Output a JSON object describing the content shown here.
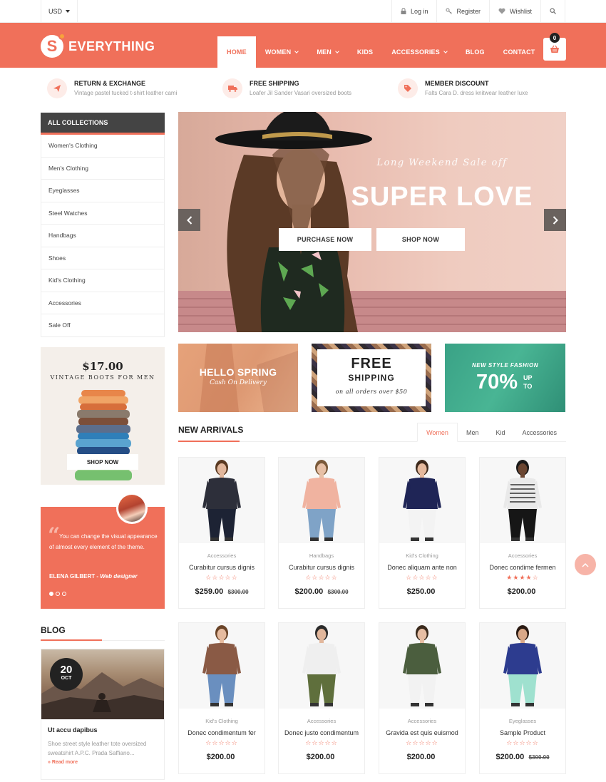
{
  "topbar": {
    "currency": "USD",
    "login": "Log in",
    "register": "Register",
    "wishlist": "Wishlist"
  },
  "brand": {
    "logo_letter": "S",
    "name": "EVERYTHING",
    "accent": "#f0705a"
  },
  "nav": {
    "home": "HOME",
    "women": "WOMEN",
    "men": "MEN",
    "kids": "KIDS",
    "accessories": "ACCESSORIES",
    "blog": "BLOG",
    "contact": "CONTACT"
  },
  "cart": {
    "count": "0"
  },
  "features": [
    {
      "title": "RETURN & EXCHANGE",
      "desc": "Vintage pastel tucked t-shirt leather cami"
    },
    {
      "title": "FREE SHIPPING",
      "desc": "Loafer Jil Sander Vasari oversized boots"
    },
    {
      "title": "MEMBER DISCOUNT",
      "desc": "Falts Cara D. dress knitwear leather luxe"
    }
  ],
  "collections": {
    "header": "ALL COLLECTIONS",
    "items": [
      "Women's Clothing",
      "Men's Clothing",
      "Eyeglasses",
      "Steel Watches",
      "Handbags",
      "Shoes",
      "Kid's Clothing",
      "Accessories",
      "Sale Off"
    ]
  },
  "promo": {
    "price": "$17.00",
    "subtitle": "VINTAGE BOOTS FOR MEN",
    "button": "SHOP NOW"
  },
  "testimonial": {
    "text": "You can change the visual appearance of almost every element of the theme.",
    "author": "ELENA GILBERT",
    "role": "Web designer"
  },
  "blog": {
    "title": "BLOG",
    "day": "20",
    "month": "OCT",
    "post_title": "Ut accu dapibus",
    "excerpt": "Shoe street style leather tote oversized sweatshirt A.P.C. Prada Saffiano...",
    "more": "» Read more"
  },
  "slider": {
    "kicker": "Long Weekend Sale off",
    "heading": "SUPER LOVE",
    "purchase": "PURCHASE NOW",
    "shop": "SHOP NOW"
  },
  "banners": {
    "spring_title": "HELLO SPRING",
    "spring_sub": "Cash On Delivery",
    "free": "FREE",
    "shipping": "SHIPPING",
    "shipping_note": "on all orders over $50",
    "fashion_kicker": "NEW STYLE FASHION",
    "fashion_pct": "70%",
    "fashion_up": "UP",
    "fashion_to": "TO"
  },
  "new_arrivals": {
    "title": "NEW ARRIVALS",
    "tabs": [
      "Women",
      "Men",
      "Kid",
      "Accessories"
    ]
  },
  "products": [
    {
      "category": "Accessories",
      "name": "Curabitur cursus dignis",
      "price": "$259.00",
      "old_price": "$300.00",
      "rating": 0
    },
    {
      "category": "Handbags",
      "name": "Curabitur cursus dignis",
      "price": "$200.00",
      "old_price": "$300.00",
      "rating": 0
    },
    {
      "category": "Kid's Clothing",
      "name": "Donec aliquam ante non",
      "price": "$250.00",
      "old_price": "",
      "rating": 0
    },
    {
      "category": "Accessories",
      "name": "Donec condime fermen",
      "price": "$200.00",
      "old_price": "",
      "rating": 4
    },
    {
      "category": "Kid's Clothing",
      "name": "Donec condimentum fer",
      "price": "$200.00",
      "old_price": "",
      "rating": 0
    },
    {
      "category": "Accessories",
      "name": "Donec justo condimentum",
      "price": "$200.00",
      "old_price": "",
      "rating": 0
    },
    {
      "category": "Accessories",
      "name": "Gravida est quis euismod",
      "price": "$200.00",
      "old_price": "",
      "rating": 0
    },
    {
      "category": "Eyeglasses",
      "name": "Sample Product",
      "price": "$200.00",
      "old_price": "$300.00",
      "rating": 0
    }
  ]
}
